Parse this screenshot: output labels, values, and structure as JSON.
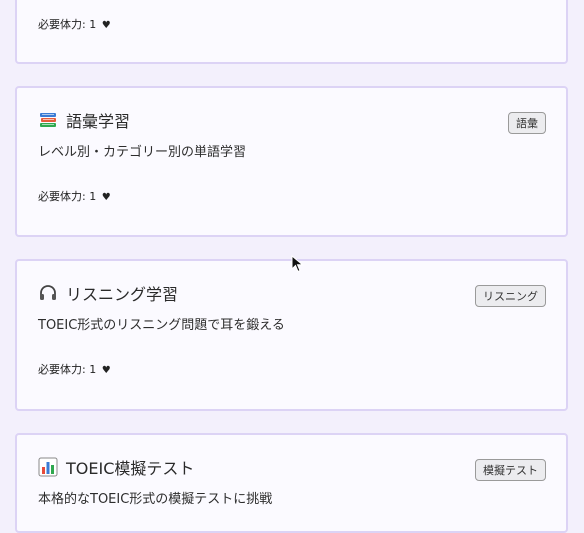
{
  "cards": [
    {
      "title": "",
      "description": "",
      "badge": "",
      "stamina_label": "必要体力: 1",
      "heart": "♥"
    },
    {
      "icon": "books-icon",
      "title": "語彙学習",
      "description": "レベル別・カテゴリー別の単語学習",
      "badge": "語彙",
      "stamina_label": "必要体力: 1",
      "heart": "♥"
    },
    {
      "icon": "headphones-icon",
      "title": "リスニング学習",
      "description": "TOEIC形式のリスニング問題で耳を鍛える",
      "badge": "リスニング",
      "stamina_label": "必要体力: 1",
      "heart": "♥"
    },
    {
      "icon": "bar-chart-icon",
      "title": "TOEIC模擬テスト",
      "description": "本格的なTOEIC形式の模擬テストに挑戦",
      "badge": "模擬テスト"
    }
  ],
  "colors": {
    "page_background": "#f3f0fc",
    "card_background": "#fbfaff",
    "card_border": "#dcd3f5",
    "badge_background": "#ececef"
  }
}
